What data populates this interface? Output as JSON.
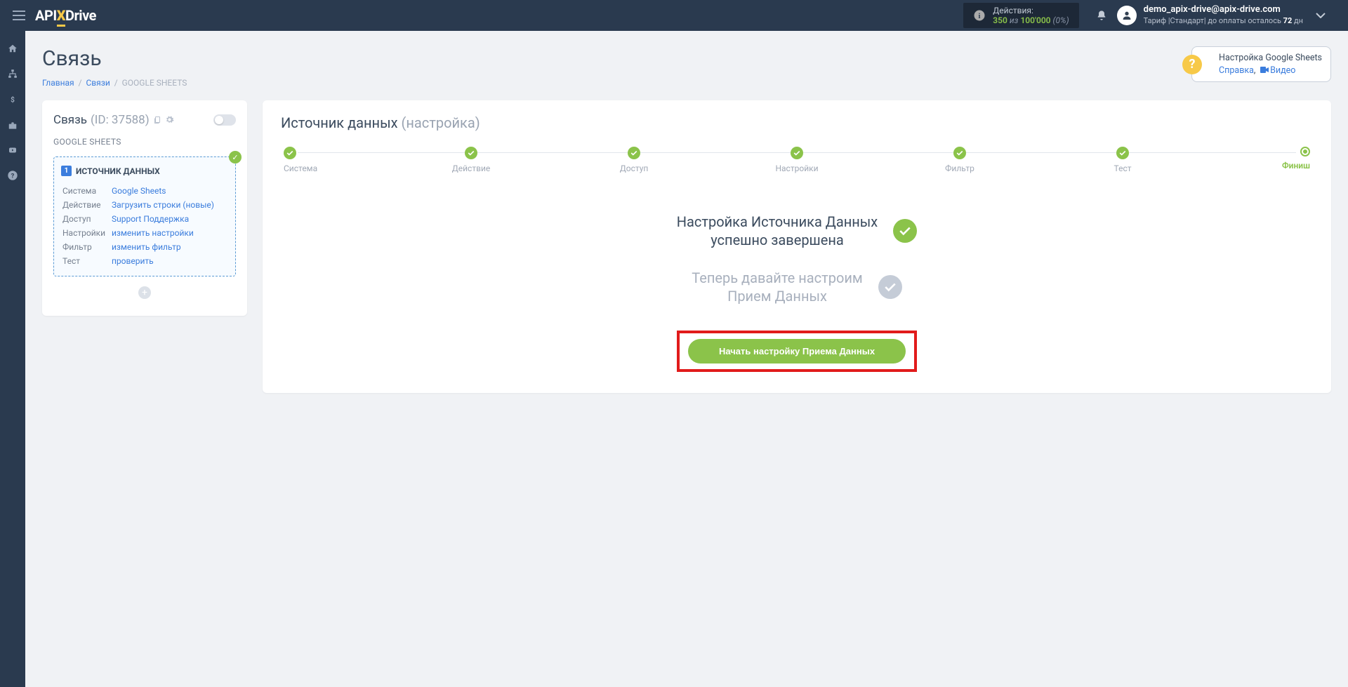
{
  "header": {
    "logo_pre": "API",
    "logo_x": "X",
    "logo_post": "Drive",
    "actions_label": "Действия:",
    "actions_used": "350",
    "actions_of": "из",
    "actions_total": "100'000",
    "actions_pct": "(0%)",
    "user_email": "demo_apix-drive@apix-drive.com",
    "user_tariff": "Тариф |Стандарт| до оплаты осталось ",
    "user_days": "72",
    "user_days_unit": " дн"
  },
  "page": {
    "title": "Связь",
    "crumb_home": "Главная",
    "crumb_links": "Связи",
    "crumb_current": "GOOGLE SHEETS",
    "help_title": "Настройка Google Sheets",
    "help_link1": "Справка",
    "help_link2": "Видео"
  },
  "left": {
    "title_main": "Связь ",
    "title_id": "(ID: 37588)",
    "subtitle": "GOOGLE SHEETS",
    "box_title": "ИСТОЧНИК ДАННЫХ",
    "rows": [
      {
        "k": "Система",
        "v": "Google Sheets"
      },
      {
        "k": "Действие",
        "v": "Загрузить строки (новые)"
      },
      {
        "k": "Доступ",
        "v": "Support Поддержка"
      },
      {
        "k": "Настройки",
        "v": "изменить настройки"
      },
      {
        "k": "Фильтр",
        "v": "изменить фильтр"
      },
      {
        "k": "Тест",
        "v": "проверить"
      }
    ]
  },
  "right": {
    "title_main": "Источник данных ",
    "title_sub": "(настройка)",
    "steps": [
      "Система",
      "Действие",
      "Доступ",
      "Настройки",
      "Фильтр",
      "Тест",
      "Финиш"
    ],
    "status1_line1": "Настройка Источника Данных",
    "status1_line2": "успешно завершена",
    "status2_line1": "Теперь давайте настроим",
    "status2_line2": "Прием Данных",
    "btn_label": "Начать настройку Приема Данных"
  }
}
